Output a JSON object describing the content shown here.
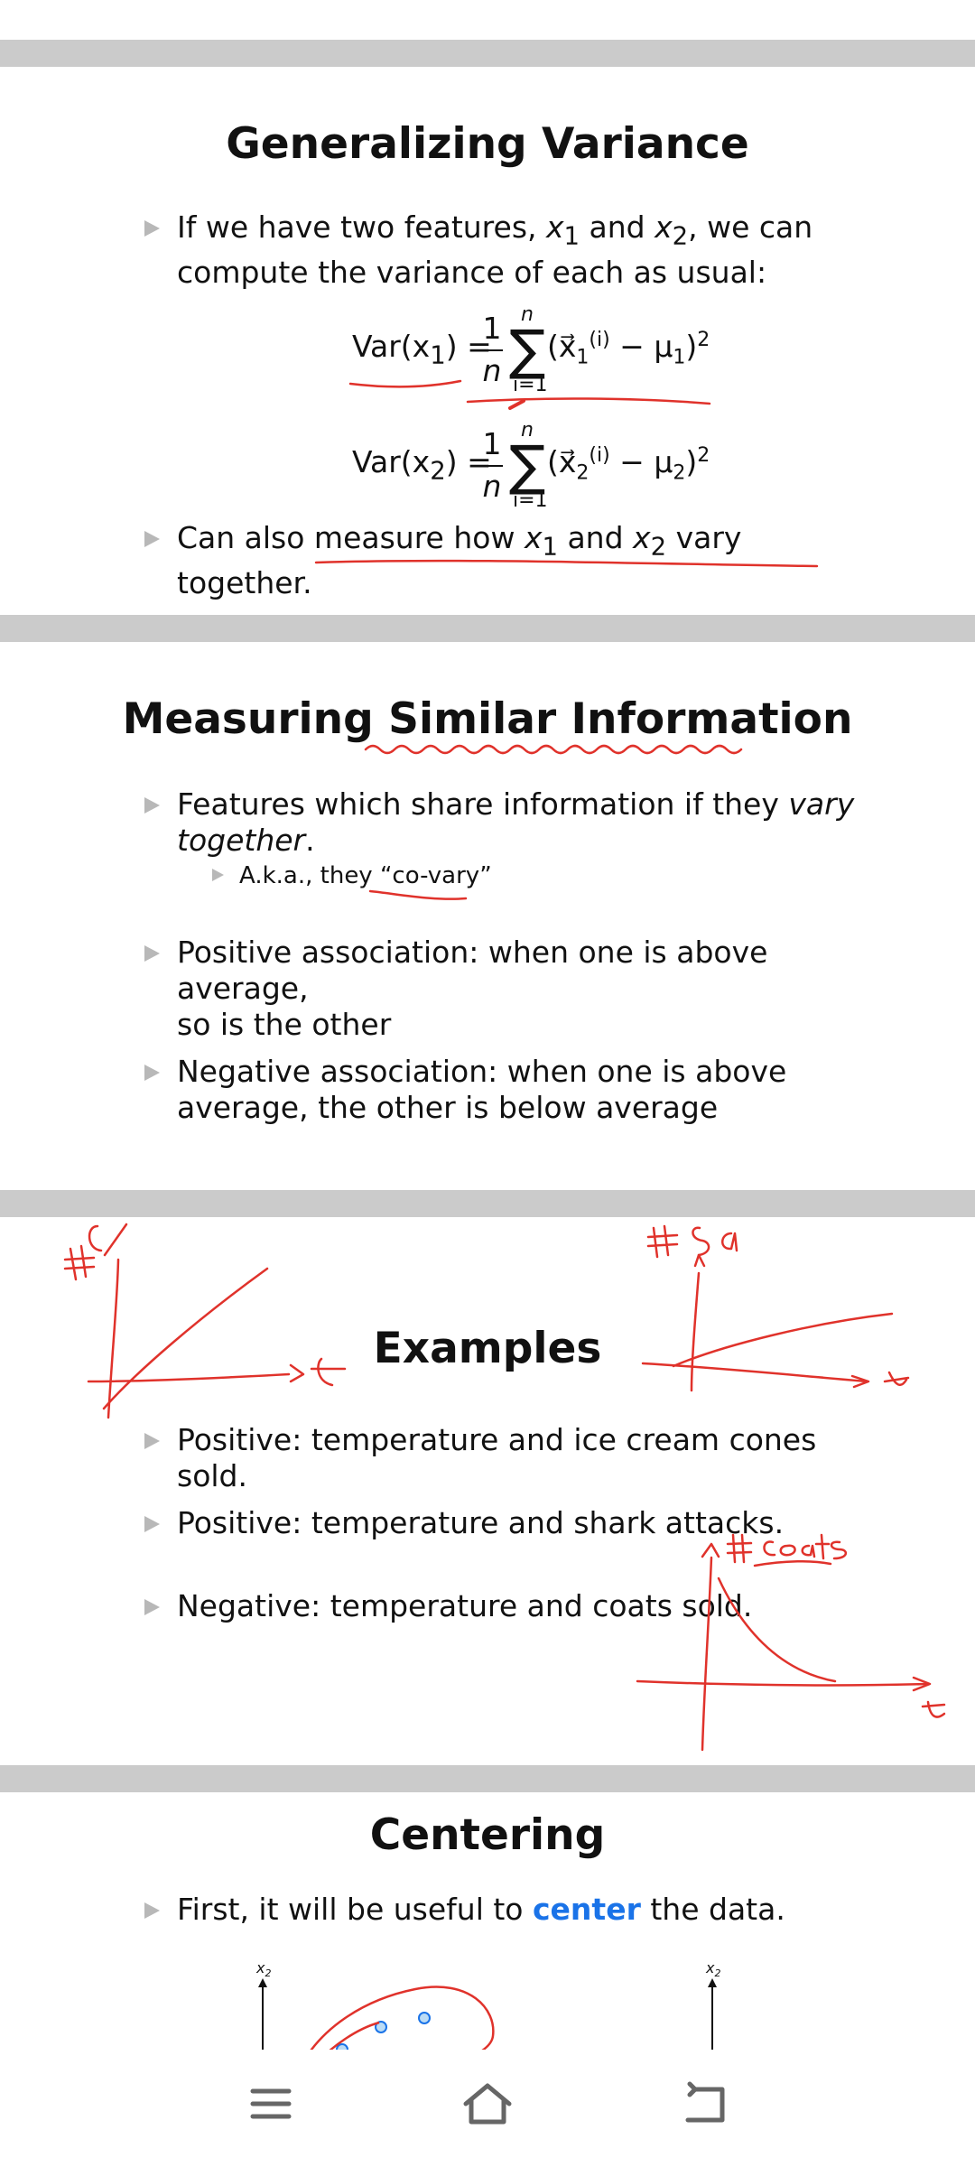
{
  "slide1": {
    "title": "Generalizing Variance",
    "bullet1_pre": "If we have two features, ",
    "x1": "x",
    "x1_sub": "1",
    "and": " and ",
    "x2": "x",
    "x2_sub": "2",
    "bullet1_post": ", we can",
    "bullet1_line2": "compute the variance of each as usual:",
    "eq1_lhs": "Var(x",
    "eq1_lhs_sub": "1",
    "eq1_lhs_end": ") =",
    "eq_one": "1",
    "eq_n": "n",
    "eq_sum_top": "n",
    "eq_sum_bottom": "i=1",
    "eq1_body": "(x⃗",
    "eq1_body_sub": "1",
    "eq1_body_sup": "(i)",
    "eq1_body_mid": " − μ",
    "eq1_mu_sub": "1",
    "eq1_body_end": ")",
    "eq_sq": "2",
    "eq2_lhs": "Var(x",
    "eq2_lhs_sub": "2",
    "eq2_lhs_end": ") =",
    "eq2_body": "(x⃗",
    "eq2_body_sub": "2",
    "eq2_body_sup": "(i)",
    "eq2_body_mid": " − μ",
    "eq2_mu_sub": "2",
    "eq2_body_end": ")",
    "bullet2_pre": "Can also measure how ",
    "bullet2_x1": "x",
    "bullet2_x1_sub": "1",
    "bullet2_and": " and ",
    "bullet2_x2": "x",
    "bullet2_x2_sub": "2",
    "bullet2_post": " vary together."
  },
  "slide2": {
    "title": "Measuring Similar Information",
    "bullet1_pre": "Features which share information if they ",
    "bullet1_em1": "vary",
    "bullet1_em2": "together",
    "bullet1_end": ".",
    "sub": "A.k.a., they “co-vary”",
    "bullet2_line1": "Positive association: when one is above average,",
    "bullet2_line2": "so is the other",
    "bullet3_line1": "Negative association: when one is above",
    "bullet3_line2": "average, the other is below average"
  },
  "slide3": {
    "title": "Examples",
    "bullet1": "Positive: temperature and ice cream cones sold.",
    "bullet2": "Positive: temperature and shark attacks.",
    "bullet3": "Negative: temperature and coats sold."
  },
  "slide4": {
    "title": "Centering",
    "bullet_pre": "First, it will be useful to ",
    "bullet_accent": "center",
    "bullet_post": " the data.",
    "axis_label_left": "x",
    "axis_label_left_sub": "2",
    "axis_label_right": "x",
    "axis_label_right_sub": "2"
  },
  "colors": {
    "ink": "#e0322b",
    "accent": "#1a73e8",
    "divider": "#cbcbcb",
    "bullet_marker": "#b8b8b8",
    "point_fill": "#bcdcf5",
    "point_stroke": "#1a73e8"
  },
  "navigation": {
    "menu_icon": "menu-icon",
    "home_icon": "home-icon",
    "back_icon": "back-icon"
  }
}
